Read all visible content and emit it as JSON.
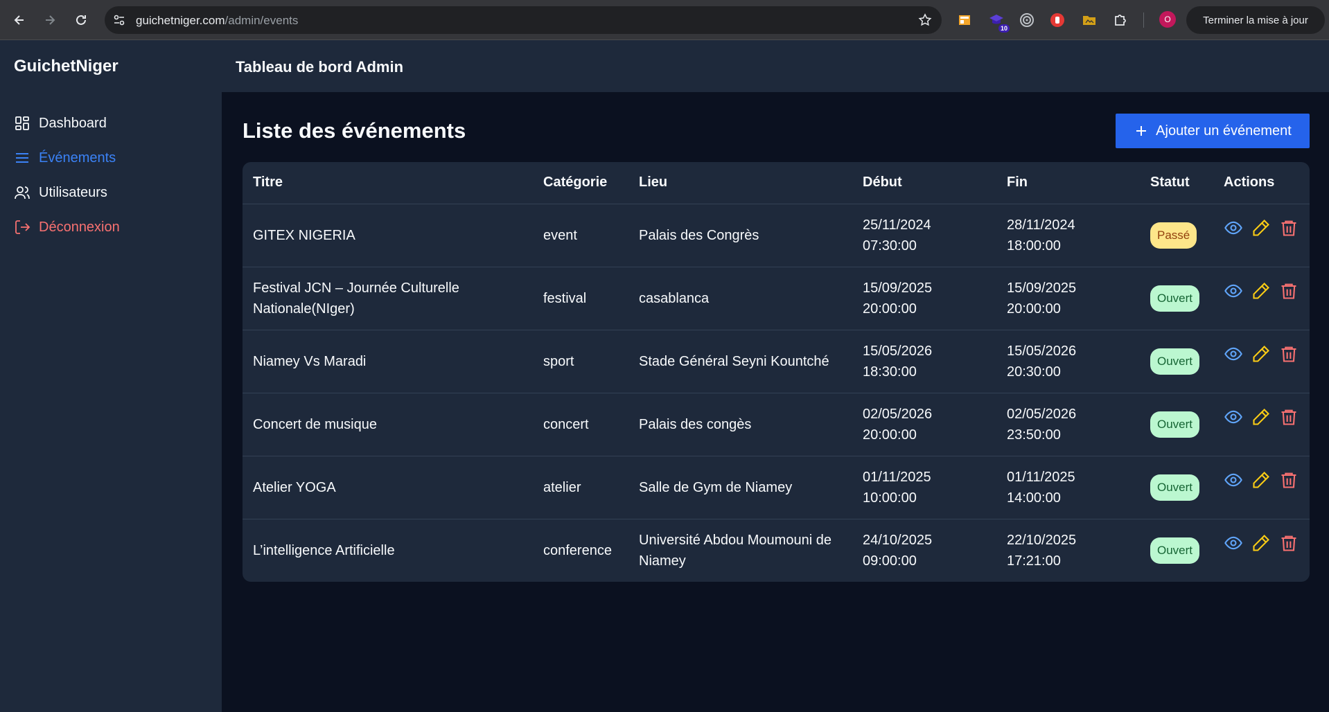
{
  "browser": {
    "url_domain": "guichetniger.com",
    "url_path": "/admin/events",
    "ext_badge": "10",
    "profile_initial": "O",
    "update_label": "Terminer la mise à jour"
  },
  "sidebar": {
    "brand": "GuichetNiger",
    "items": [
      {
        "label": "Dashboard",
        "icon": "dashboard-icon",
        "color": "#f8fafc"
      },
      {
        "label": "Événements",
        "icon": "list-icon",
        "color": "#3b82f6",
        "active": true
      },
      {
        "label": "Utilisateurs",
        "icon": "users-icon",
        "color": "#f8fafc"
      },
      {
        "label": "Déconnexion",
        "icon": "logout-icon",
        "color": "#f87171"
      }
    ]
  },
  "header": {
    "title": "Tableau de bord Admin"
  },
  "main": {
    "title": "Liste des événements",
    "add_button": "Ajouter un événement"
  },
  "table": {
    "columns": [
      "Titre",
      "Catégorie",
      "Lieu",
      "Début",
      "Fin",
      "Statut",
      "Actions"
    ],
    "rows": [
      {
        "titre": "GITEX NIGERIA",
        "categorie": "event",
        "lieu": "Palais des Congrès",
        "debut_date": "25/11/2024",
        "debut_time": "07:30:00",
        "fin_date": "28/11/2024",
        "fin_time": "18:00:00",
        "statut": "Passé"
      },
      {
        "titre": "Festival JCN – Journée Culturelle Nationale(NIger)",
        "categorie": "festival",
        "lieu": "casablanca",
        "debut_date": "15/09/2025",
        "debut_time": "20:00:00",
        "fin_date": "15/09/2025",
        "fin_time": "20:00:00",
        "statut": "Ouvert"
      },
      {
        "titre": "Niamey Vs Maradi",
        "categorie": "sport",
        "lieu": "Stade Général Seyni Kountché",
        "debut_date": "15/05/2026",
        "debut_time": "18:30:00",
        "fin_date": "15/05/2026",
        "fin_time": "20:30:00",
        "statut": "Ouvert"
      },
      {
        "titre": "Concert de musique",
        "categorie": "concert",
        "lieu": "Palais des congès",
        "debut_date": "02/05/2026",
        "debut_time": "20:00:00",
        "fin_date": "02/05/2026",
        "fin_time": "23:50:00",
        "statut": "Ouvert"
      },
      {
        "titre": "Atelier YOGA",
        "categorie": "atelier",
        "lieu": "Salle de Gym de Niamey",
        "debut_date": "01/11/2025",
        "debut_time": "10:00:00",
        "fin_date": "01/11/2025",
        "fin_time": "14:00:00",
        "statut": "Ouvert"
      },
      {
        "titre": "L’intelligence Artificielle",
        "categorie": "conference",
        "lieu": "Université Abdou Moumouni de Niamey",
        "debut_date": "24/10/2025",
        "debut_time": "09:00:00",
        "fin_date": "22/10/2025",
        "fin_time": "17:21:00",
        "statut": "Ouvert"
      }
    ]
  },
  "colors": {
    "accent": "#2563eb",
    "status_passe_bg": "#fde68a",
    "status_passe_fg": "#92400e",
    "status_ouvert_bg": "#bbf7d0",
    "status_ouvert_fg": "#166534",
    "view_icon": "#60a5fa",
    "edit_icon": "#facc15",
    "delete_icon": "#f87171"
  }
}
